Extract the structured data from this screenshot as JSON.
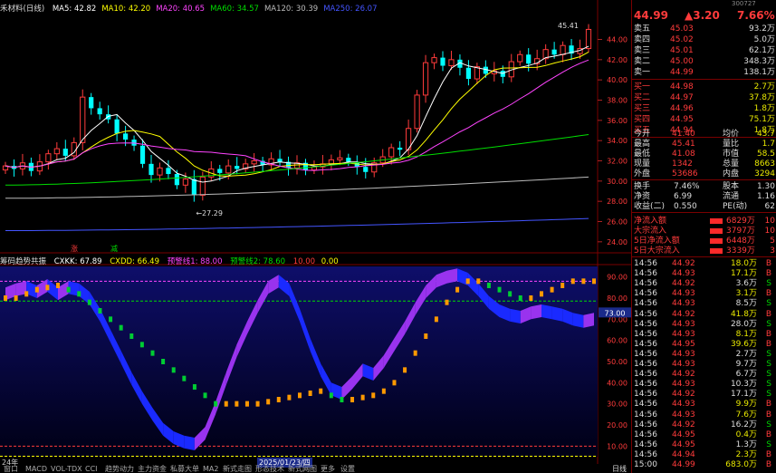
{
  "header": {
    "stock_short": "禾材料(日线)",
    "ma": [
      {
        "label": "MA5: 42.82",
        "color": "#ffffff"
      },
      {
        "label": "MA10: 42.20",
        "color": "#ffff00"
      },
      {
        "label": "MA20: 40.65",
        "color": "#ff44ff"
      },
      {
        "label": "MA60: 34.57",
        "color": "#00dd00"
      },
      {
        "label": "MA120: 30.39",
        "color": "#bbbbbb"
      },
      {
        "label": "MA250: 26.07",
        "color": "#4455ff"
      }
    ]
  },
  "quote": {
    "code": "300727",
    "name": "润禾材料",
    "price": "44.99",
    "change": "▲3.20",
    "pct": "7.66%"
  },
  "price_axis": [
    "44.00",
    "42.00",
    "40.00",
    "38.00",
    "36.00",
    "34.00",
    "32.00",
    "30.00",
    "28.00",
    "26.00",
    "24.00"
  ],
  "price_range": [
    23.0,
    47.0
  ],
  "annotations": {
    "high": "45.41",
    "low": "27.29",
    "zhang": "涨",
    "jian": "减"
  },
  "indicator": {
    "name": "筹码趋势共振",
    "cxkk": "CXKK: 67.89",
    "cxdd": "CXDD: 66.49",
    "line1": "预警线1: 88.00",
    "line2": "预警线2: 78.60",
    "v10": "10.00",
    "v0": "0.00",
    "axis": [
      "90.00",
      "80.00",
      "70.00",
      "60.00",
      "50.00",
      "40.00",
      "30.00",
      "20.00",
      "10.00"
    ],
    "current": "73.00"
  },
  "date_axis": {
    "left": "24年",
    "mid": "2025/01/23/四"
  },
  "bottom_tabs": [
    "窗口",
    "MACD",
    "VOL-TDX",
    "CCI",
    "趋势动力",
    "主力资金",
    "私募大单",
    "MA2",
    "新式走图",
    "形态技术",
    "新式网图",
    "更多",
    "设置"
  ],
  "bottom_right": "日线",
  "order_book": {
    "sell": [
      {
        "label": "卖五",
        "price": "45.03",
        "vol": "93.2万"
      },
      {
        "label": "卖四",
        "price": "45.02",
        "vol": "5.0万"
      },
      {
        "label": "卖三",
        "price": "45.01",
        "vol": "62.1万"
      },
      {
        "label": "卖二",
        "price": "45.00",
        "vol": "348.3万"
      },
      {
        "label": "卖一",
        "price": "44.99",
        "vol": "138.1万"
      }
    ],
    "buy": [
      {
        "label": "买一",
        "price": "44.98",
        "vol": "2.7万"
      },
      {
        "label": "买二",
        "price": "44.97",
        "vol": "37.8万"
      },
      {
        "label": "买三",
        "price": "44.96",
        "vol": "1.8万"
      },
      {
        "label": "买四",
        "price": "44.95",
        "vol": "75.1万"
      },
      {
        "label": "买五",
        "price": "44.94",
        "vol": "1.8万"
      }
    ]
  },
  "stats": [
    {
      "k1": "今开",
      "v1": "41.40",
      "k2": "均价",
      "v2": "43.7"
    },
    {
      "k1": "最高",
      "v1": "45.41",
      "k2": "量比",
      "v2": "1.7"
    },
    {
      "k1": "最低",
      "v1": "41.08",
      "k2": "市值",
      "v2": "58.5"
    },
    {
      "k1": "现量",
      "v1": "1342",
      "k2": "总量",
      "v2": "8663"
    },
    {
      "k1": "外盘",
      "v1": "53686",
      "k2": "内盘",
      "v2": "3294"
    }
  ],
  "stats2": [
    {
      "k1": "换手",
      "v1": "7.46%",
      "k2": "股本",
      "v2": "1.30"
    },
    {
      "k1": "净资",
      "v1": "6.99",
      "k2": "流通",
      "v2": "1.16"
    },
    {
      "k1": "收益(二)",
      "v1": "0.550",
      "k2": "PE(动)",
      "v2": "62"
    }
  ],
  "flows": [
    {
      "label": "净流入额",
      "value": "6829万",
      "tail": "10"
    },
    {
      "label": "大宗流入",
      "value": "3797万",
      "tail": "10"
    },
    {
      "label": "5日净流入额",
      "value": "6448万",
      "tail": "5"
    },
    {
      "label": "5日大宗流入",
      "value": "3339万",
      "tail": "3"
    }
  ],
  "ticks": [
    {
      "t": "14:56",
      "p": "44.92",
      "v": "18.0万",
      "s": "B"
    },
    {
      "t": "14:56",
      "p": "44.93",
      "v": "17.1万",
      "s": "B"
    },
    {
      "t": "14:56",
      "p": "44.92",
      "v": "3.6万",
      "s": "S"
    },
    {
      "t": "14:56",
      "p": "44.93",
      "v": "3.1万",
      "s": "B"
    },
    {
      "t": "14:56",
      "p": "44.93",
      "v": "8.5万",
      "s": "S"
    },
    {
      "t": "14:56",
      "p": "44.92",
      "v": "41.8万",
      "s": "B"
    },
    {
      "t": "14:56",
      "p": "44.93",
      "v": "28.0万",
      "s": "S"
    },
    {
      "t": "14:56",
      "p": "44.93",
      "v": "8.1万",
      "s": "B"
    },
    {
      "t": "14:56",
      "p": "44.95",
      "v": "39.6万",
      "s": "B"
    },
    {
      "t": "14:56",
      "p": "44.93",
      "v": "2.7万",
      "s": "S"
    },
    {
      "t": "14:56",
      "p": "44.93",
      "v": "9.7万",
      "s": "S"
    },
    {
      "t": "14:56",
      "p": "44.92",
      "v": "6.7万",
      "s": "S"
    },
    {
      "t": "14:56",
      "p": "44.93",
      "v": "10.3万",
      "s": "S"
    },
    {
      "t": "14:56",
      "p": "44.92",
      "v": "17.1万",
      "s": "S"
    },
    {
      "t": "14:56",
      "p": "44.93",
      "v": "9.9万",
      "s": "B"
    },
    {
      "t": "14:56",
      "p": "44.93",
      "v": "7.6万",
      "s": "B"
    },
    {
      "t": "14:56",
      "p": "44.92",
      "v": "16.2万",
      "s": "S"
    },
    {
      "t": "14:56",
      "p": "44.95",
      "v": "0.4万",
      "s": "B"
    },
    {
      "t": "14:56",
      "p": "44.95",
      "v": "1.3万",
      "s": "S"
    },
    {
      "t": "14:56",
      "p": "44.94",
      "v": "2.3万",
      "s": "B"
    },
    {
      "t": "15:00",
      "p": "44.99",
      "v": "683.0万",
      "s": "B"
    }
  ],
  "colors": {
    "up": "#ff3b3b",
    "down": "#00ffff",
    "frame": "#7a0000",
    "indicator_bg": "#0a0a3a"
  }
}
